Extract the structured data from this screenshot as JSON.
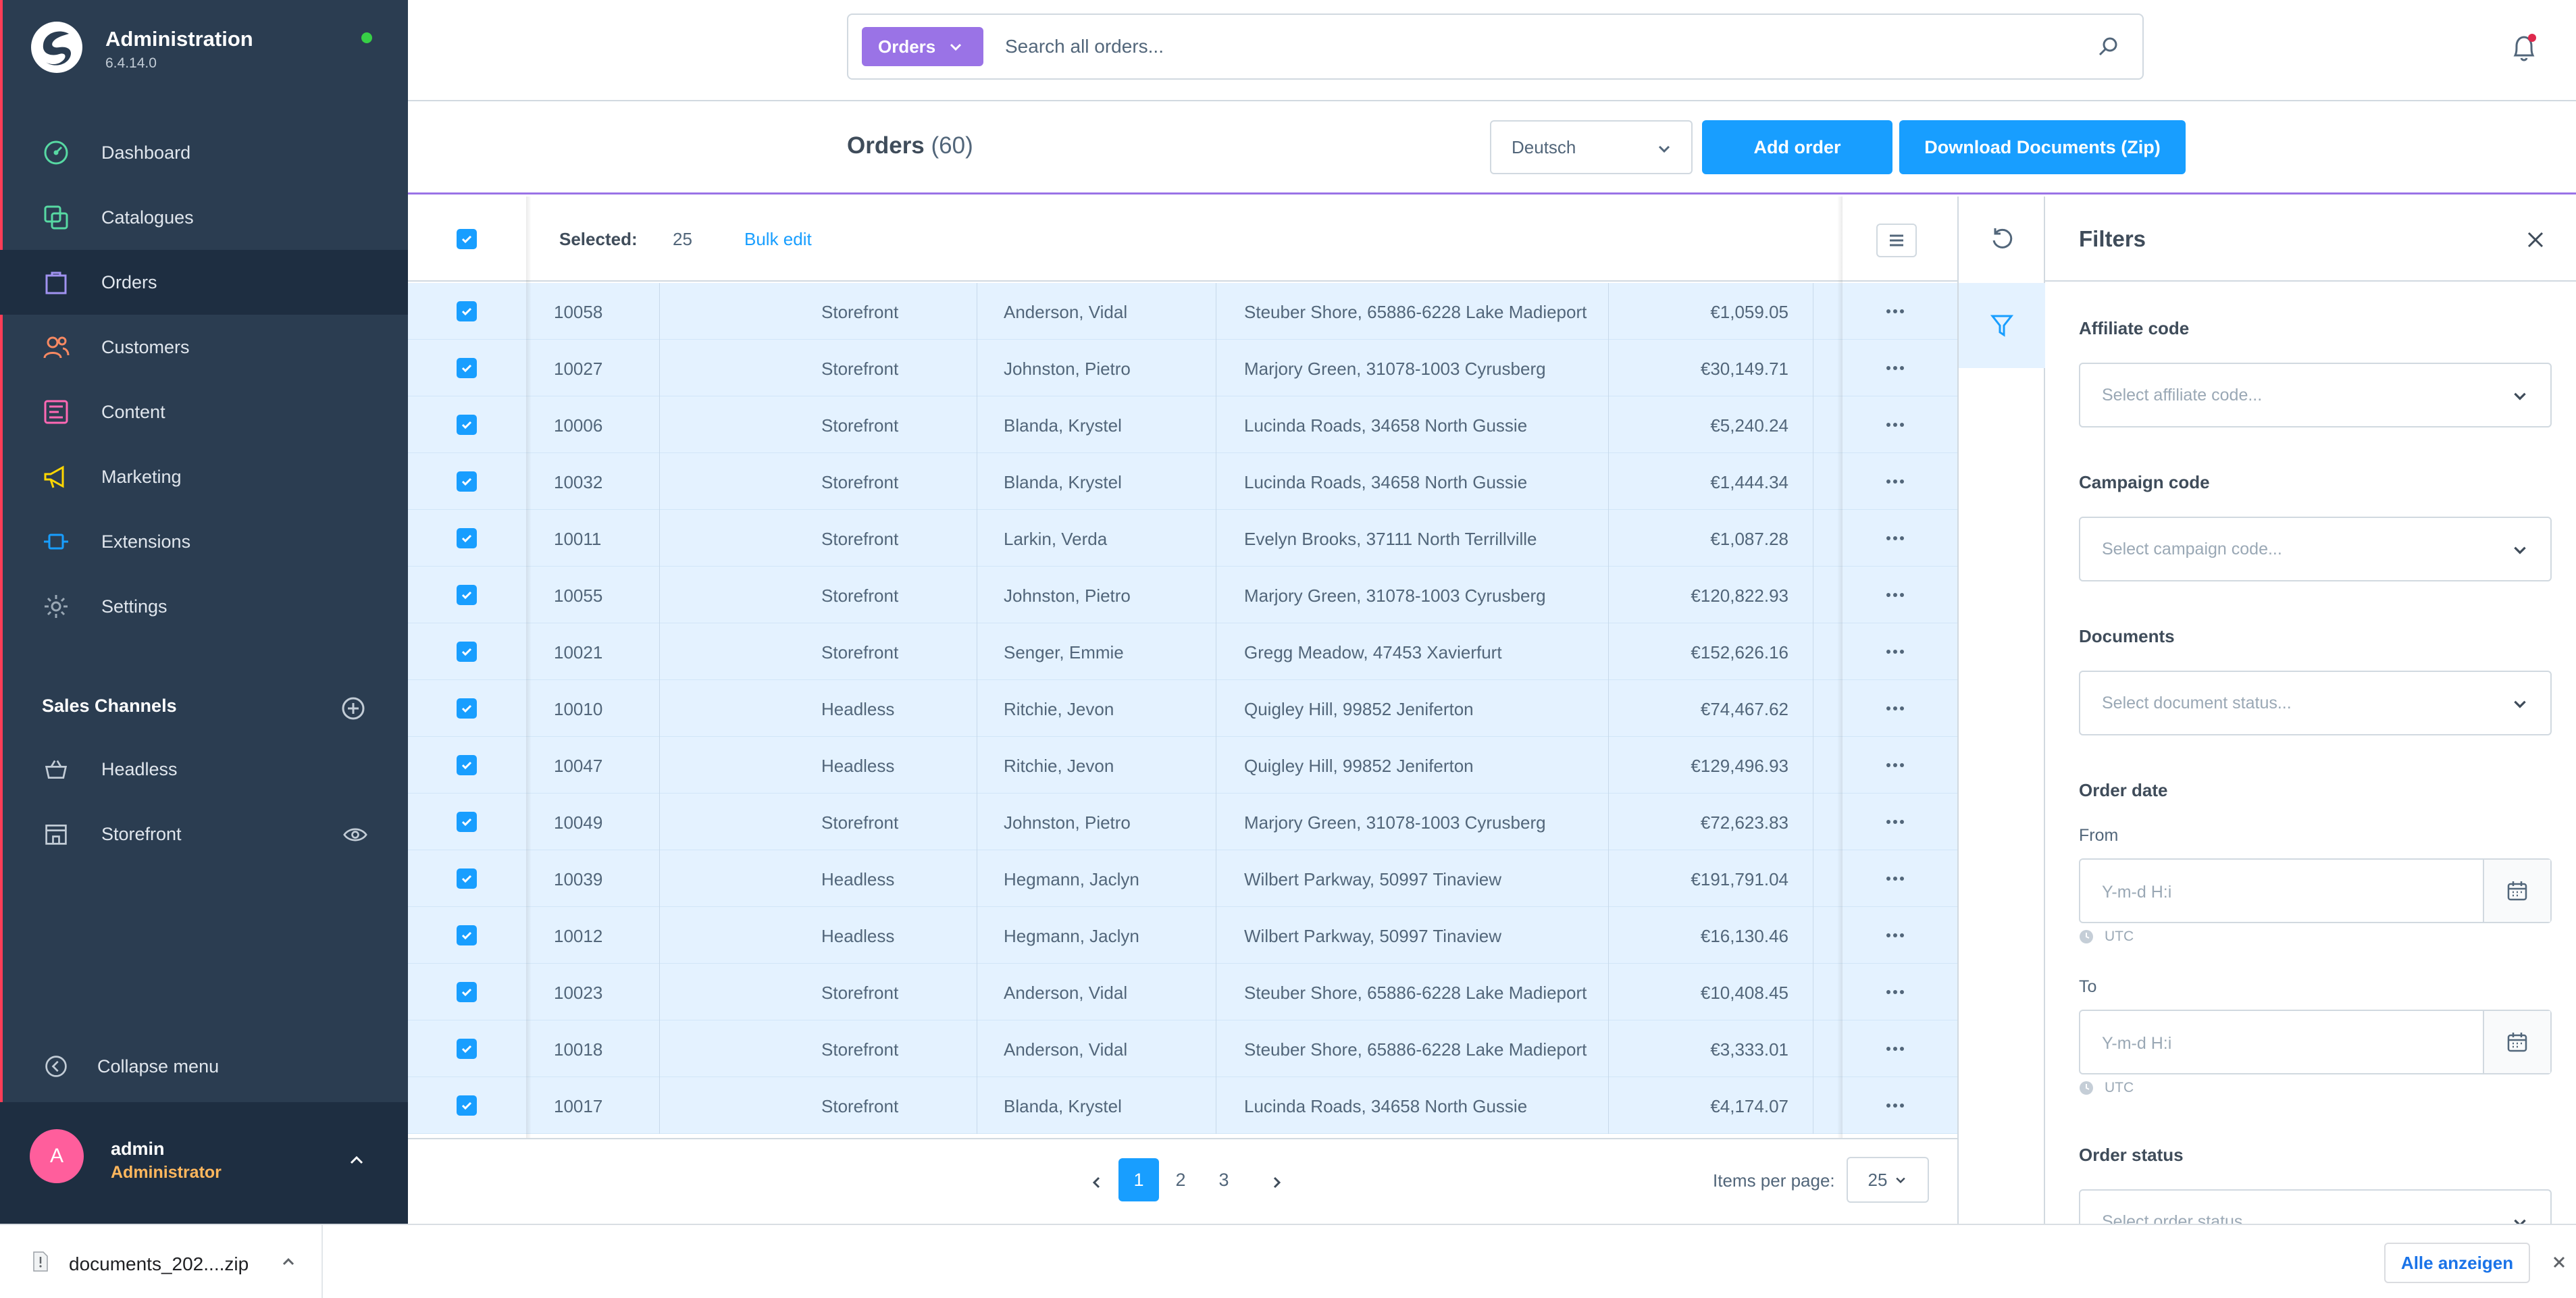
{
  "app": {
    "title": "Administration",
    "version": "6.4.14.0"
  },
  "sidebar": {
    "items": [
      {
        "label": "Dashboard",
        "icon": "dashboard-icon",
        "color": "#57d9a3"
      },
      {
        "label": "Catalogues",
        "icon": "catalogue-icon",
        "color": "#57d9a3"
      },
      {
        "label": "Orders",
        "icon": "orders-icon",
        "color": "#a092f0"
      },
      {
        "label": "Customers",
        "icon": "customers-icon",
        "color": "#f88962"
      },
      {
        "label": "Content",
        "icon": "content-icon",
        "color": "#ff68b4"
      },
      {
        "label": "Marketing",
        "icon": "marketing-icon",
        "color": "#ffd700"
      },
      {
        "label": "Extensions",
        "icon": "extensions-icon",
        "color": "#189eff"
      },
      {
        "label": "Settings",
        "icon": "settings-icon",
        "color": "#9aa8b5"
      }
    ],
    "sales_channels_heading": "Sales Channels",
    "sales_channels": [
      {
        "label": "Headless",
        "icon": "basket-icon"
      },
      {
        "label": "Storefront",
        "icon": "storefront-icon"
      }
    ],
    "collapse_label": "Collapse menu",
    "user": {
      "initial": "A",
      "name": "admin",
      "role": "Administrator"
    }
  },
  "search": {
    "type_label": "Orders",
    "placeholder": "Search all orders..."
  },
  "header": {
    "title": "Orders",
    "count": "(60)",
    "language": "Deutsch",
    "add_order": "Add order",
    "download_docs": "Download Documents (Zip)"
  },
  "grid": {
    "selected_label": "Selected:",
    "selected_count": "25",
    "bulk_edit": "Bulk edit",
    "rows": [
      {
        "number": "10058",
        "channel": "Storefront",
        "customer": "Anderson, Vidal",
        "address": "Steuber Shore, 65886-6228 Lake Madieport",
        "amount": "€1,059.05"
      },
      {
        "number": "10027",
        "channel": "Storefront",
        "customer": "Johnston, Pietro",
        "address": "Marjory Green, 31078-1003 Cyrusberg",
        "amount": "€30,149.71"
      },
      {
        "number": "10006",
        "channel": "Storefront",
        "customer": "Blanda, Krystel",
        "address": "Lucinda Roads, 34658 North Gussie",
        "amount": "€5,240.24"
      },
      {
        "number": "10032",
        "channel": "Storefront",
        "customer": "Blanda, Krystel",
        "address": "Lucinda Roads, 34658 North Gussie",
        "amount": "€1,444.34"
      },
      {
        "number": "10011",
        "channel": "Storefront",
        "customer": "Larkin, Verda",
        "address": "Evelyn Brooks, 37111 North Terrillville",
        "amount": "€1,087.28"
      },
      {
        "number": "10055",
        "channel": "Storefront",
        "customer": "Johnston, Pietro",
        "address": "Marjory Green, 31078-1003 Cyrusberg",
        "amount": "€120,822.93"
      },
      {
        "number": "10021",
        "channel": "Storefront",
        "customer": "Senger, Emmie",
        "address": "Gregg Meadow, 47453 Xavierfurt",
        "amount": "€152,626.16"
      },
      {
        "number": "10010",
        "channel": "Headless",
        "customer": "Ritchie, Jevon",
        "address": "Quigley Hill, 99852 Jeniferton",
        "amount": "€74,467.62"
      },
      {
        "number": "10047",
        "channel": "Headless",
        "customer": "Ritchie, Jevon",
        "address": "Quigley Hill, 99852 Jeniferton",
        "amount": "€129,496.93"
      },
      {
        "number": "10049",
        "channel": "Storefront",
        "customer": "Johnston, Pietro",
        "address": "Marjory Green, 31078-1003 Cyrusberg",
        "amount": "€72,623.83"
      },
      {
        "number": "10039",
        "channel": "Headless",
        "customer": "Hegmann, Jaclyn",
        "address": "Wilbert Parkway, 50997 Tinaview",
        "amount": "€191,791.04"
      },
      {
        "number": "10012",
        "channel": "Headless",
        "customer": "Hegmann, Jaclyn",
        "address": "Wilbert Parkway, 50997 Tinaview",
        "amount": "€16,130.46"
      },
      {
        "number": "10023",
        "channel": "Storefront",
        "customer": "Anderson, Vidal",
        "address": "Steuber Shore, 65886-6228 Lake Madieport",
        "amount": "€10,408.45"
      },
      {
        "number": "10018",
        "channel": "Storefront",
        "customer": "Anderson, Vidal",
        "address": "Steuber Shore, 65886-6228 Lake Madieport",
        "amount": "€3,333.01"
      },
      {
        "number": "10017",
        "channel": "Storefront",
        "customer": "Blanda, Krystel",
        "address": "Lucinda Roads, 34658 North Gussie",
        "amount": "€4,174.07"
      }
    ]
  },
  "pagination": {
    "pages": [
      "1",
      "2",
      "3"
    ],
    "current": "1",
    "items_per_page_label": "Items per page:",
    "items_per_page": "25"
  },
  "filters": {
    "title": "Filters",
    "affiliate_label": "Affiliate code",
    "affiliate_placeholder": "Select affiliate code...",
    "campaign_label": "Campaign code",
    "campaign_placeholder": "Select campaign code...",
    "documents_label": "Documents",
    "documents_placeholder": "Select document status...",
    "order_date_label": "Order date",
    "from_label": "From",
    "to_label": "To",
    "date_placeholder": "Y-m-d H:i",
    "timezone": "UTC",
    "order_status_label": "Order status",
    "order_status_placeholder": "Select order status..."
  },
  "download_bar": {
    "file_name": "documents_202....zip",
    "show_all": "Alle anzeigen"
  },
  "colors": {
    "primary": "#189eff",
    "sidebar_bg": "#2b3d51",
    "accent_purple": "#9a73e6",
    "row_selected_bg": "#e4f2ff"
  }
}
